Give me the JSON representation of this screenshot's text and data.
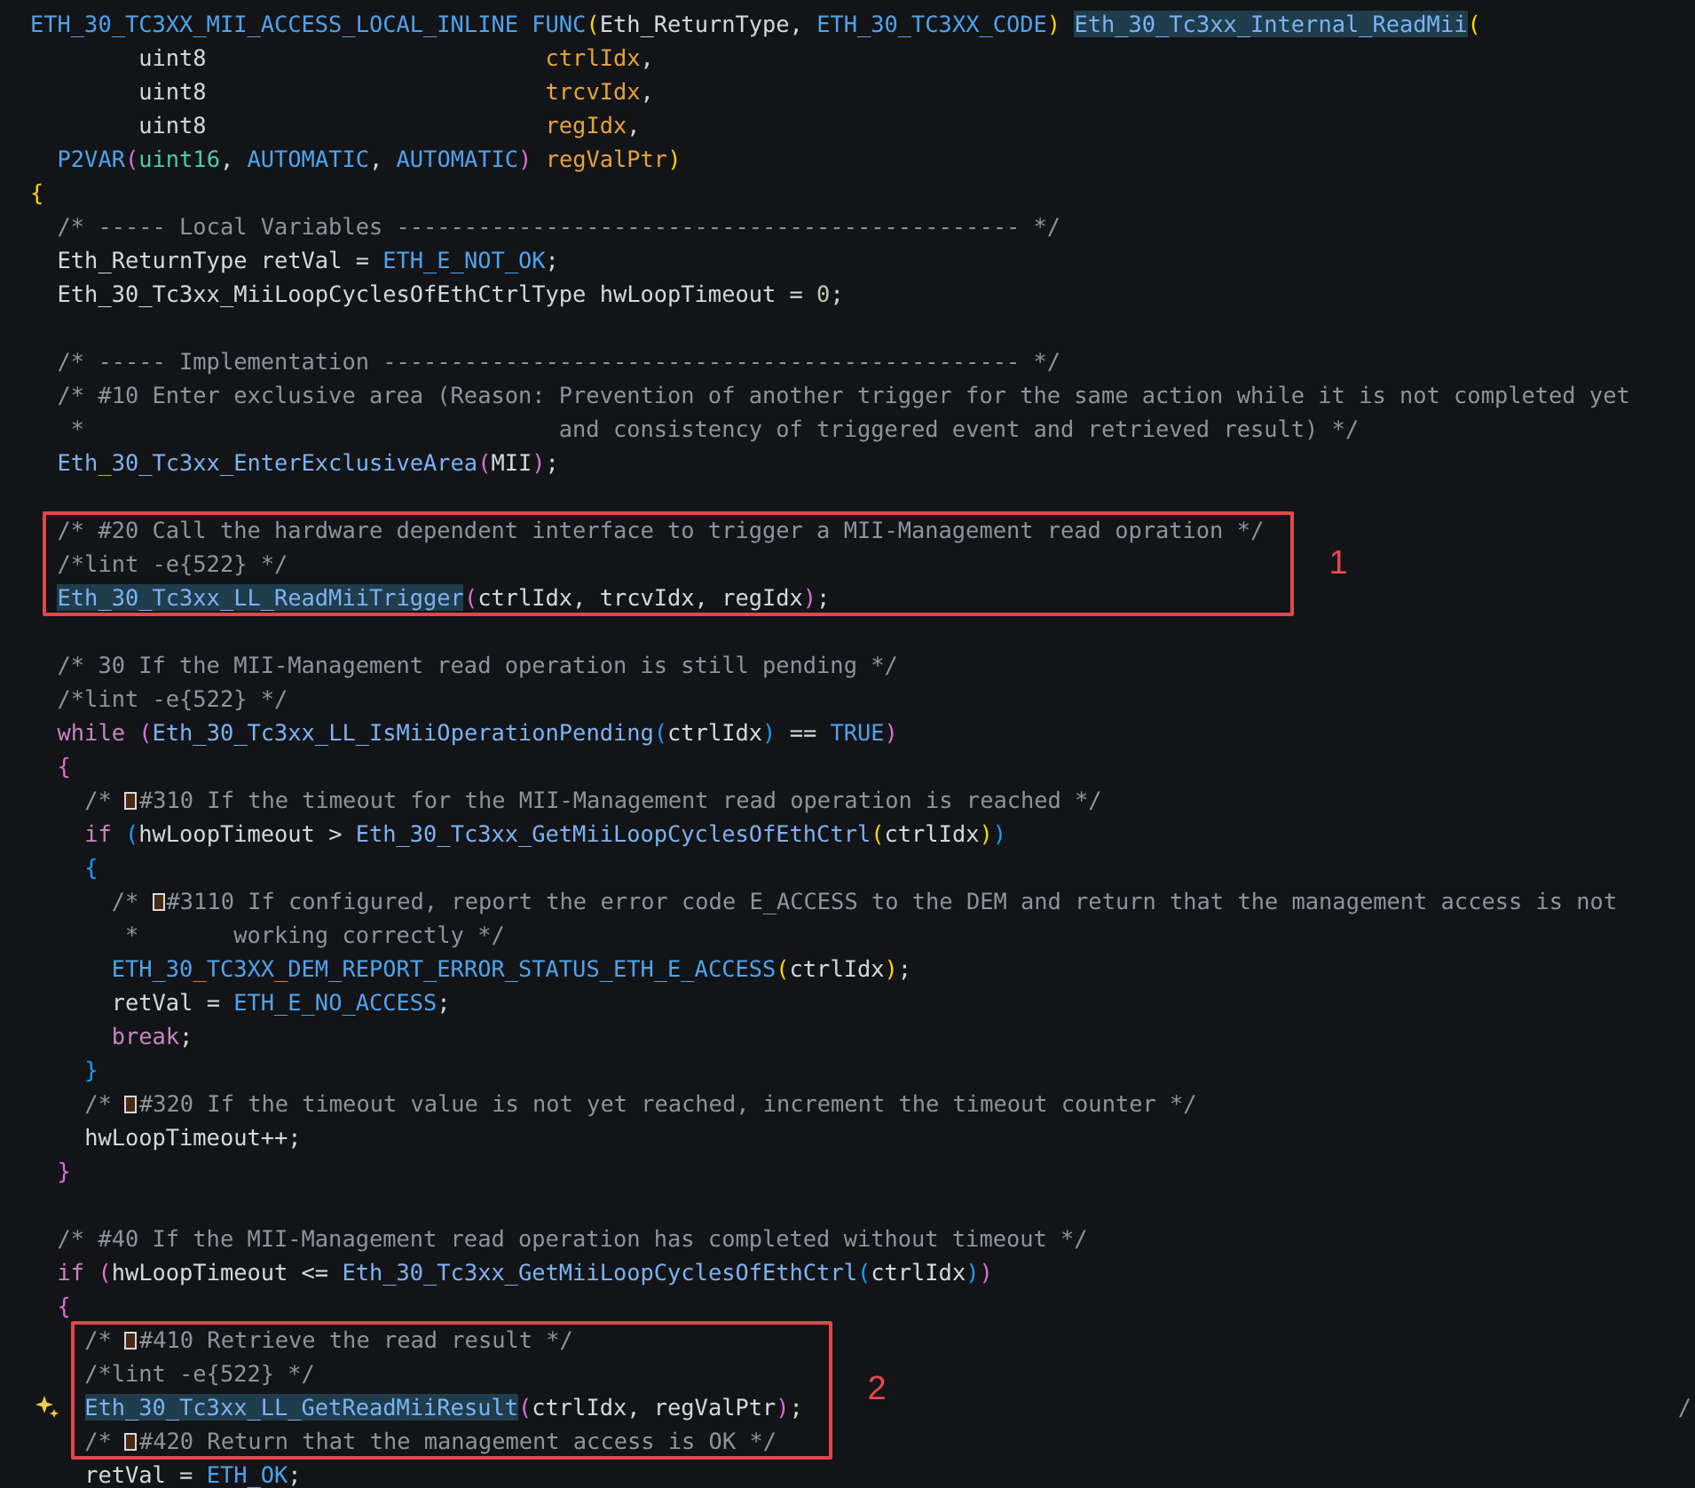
{
  "editor": {
    "lines": [
      {
        "kind": "code",
        "tokens": [
          {
            "kind": "macro",
            "text": "ETH_30_TC3XX_MII_ACCESS_LOCAL_INLINE"
          },
          {
            "kind": "macro",
            "text": " FUNC"
          },
          {
            "kind": "bracket",
            "text": "(",
            "color": "#ffd700"
          },
          {
            "kind": "plain",
            "text": "Eth_ReturnType, "
          },
          {
            "kind": "macro",
            "text": "ETH_30_TC3XX_CODE"
          },
          {
            "kind": "bracket",
            "text": ")",
            "color": "#ffd700"
          },
          {
            "kind": "fn",
            "text": " Eth_30_Tc3xx_Internal_ReadMii",
            "highlighted": true
          },
          {
            "kind": "bracket",
            "text": "(",
            "color": "#ffd700"
          }
        ]
      },
      {
        "kind": "code",
        "tokens": [
          {
            "kind": "plain",
            "text": "        uint8"
          },
          {
            "kind": "param",
            "text": "                         ctrlIdx"
          },
          {
            "kind": "plain",
            "text": ","
          }
        ]
      },
      {
        "kind": "code",
        "tokens": [
          {
            "kind": "plain",
            "text": "        uint8"
          },
          {
            "kind": "param",
            "text": "                         trcvIdx"
          },
          {
            "kind": "plain",
            "text": ","
          }
        ]
      },
      {
        "kind": "code",
        "tokens": [
          {
            "kind": "plain",
            "text": "        uint8"
          },
          {
            "kind": "param",
            "text": "                         regIdx"
          },
          {
            "kind": "plain",
            "text": ","
          }
        ]
      },
      {
        "kind": "code",
        "tokens": [
          {
            "kind": "macro",
            "text": "  P2VAR"
          },
          {
            "kind": "bracket",
            "text": "(",
            "color": "#da70d6"
          },
          {
            "kind": "type",
            "text": "uint16"
          },
          {
            "kind": "plain",
            "text": ", "
          },
          {
            "kind": "macro",
            "text": "AUTOMATIC"
          },
          {
            "kind": "plain",
            "text": ", "
          },
          {
            "kind": "macro",
            "text": "AUTOMATIC"
          },
          {
            "kind": "bracket",
            "text": ")",
            "color": "#da70d6"
          },
          {
            "kind": "param",
            "text": " regValPtr"
          },
          {
            "kind": "bracket",
            "text": ")",
            "color": "#ffd700"
          }
        ]
      },
      {
        "kind": "code",
        "tokens": [
          {
            "kind": "bracket",
            "text": "{",
            "color": "#ffd700"
          }
        ]
      },
      {
        "kind": "code",
        "tokens": [
          {
            "kind": "comment",
            "text": "  /* ----- Local Variables ---------------------------------------------- */"
          }
        ]
      },
      {
        "kind": "code",
        "tokens": [
          {
            "kind": "plain",
            "text": "  Eth_ReturnType retVal = "
          },
          {
            "kind": "macro",
            "text": "ETH_E_NOT_OK"
          },
          {
            "kind": "plain",
            "text": ";"
          }
        ]
      },
      {
        "kind": "code",
        "tokens": [
          {
            "kind": "plain",
            "text": "  Eth_30_Tc3xx_MiiLoopCyclesOfEthCtrlType hwLoopTimeout = "
          },
          {
            "kind": "number",
            "text": "0"
          },
          {
            "kind": "plain",
            "text": ";"
          }
        ]
      },
      {
        "kind": "blank"
      },
      {
        "kind": "code",
        "tokens": [
          {
            "kind": "comment",
            "text": "  /* ----- Implementation ----------------------------------------------- */"
          }
        ]
      },
      {
        "kind": "code",
        "tokens": [
          {
            "kind": "comment",
            "text": "  /* #10 Enter exclusive area (Reason: Prevention of another trigger for the same action while it is not completed yet"
          }
        ]
      },
      {
        "kind": "code",
        "tokens": [
          {
            "kind": "comment",
            "text": "   *                                   and consistency of triggered event and retrieved result) */"
          }
        ]
      },
      {
        "kind": "code",
        "tokens": [
          {
            "kind": "fn",
            "text": "  Eth_30_Tc3xx_EnterExclusiveArea",
            "highlighted": false
          },
          {
            "kind": "bracket",
            "text": "(",
            "color": "#da70d6"
          },
          {
            "kind": "plain",
            "text": "MII"
          },
          {
            "kind": "bracket",
            "text": ")",
            "color": "#da70d6"
          },
          {
            "kind": "plain",
            "text": ";"
          }
        ]
      },
      {
        "kind": "blank"
      },
      {
        "kind": "annotation",
        "label": "1",
        "lines": [
          {
            "kind": "code",
            "tokens": [
              {
                "kind": "comment",
                "text": "  /* #20 Call the hardware dependent interface to trigger a MII-Management read opration */"
              }
            ]
          },
          {
            "kind": "code",
            "tokens": [
              {
                "kind": "comment",
                "text": "  /*lint -e{522} */"
              }
            ]
          },
          {
            "kind": "code",
            "tokens": [
              {
                "kind": "fn",
                "text": "  Eth_30_Tc3xx_LL_ReadMiiTrigger",
                "highlighted": true
              },
              {
                "kind": "bracket",
                "text": "(",
                "color": "#da70d6"
              },
              {
                "kind": "plain",
                "text": "ctrlIdx, trcvIdx, regIdx"
              },
              {
                "kind": "bracket",
                "text": ")",
                "color": "#da70d6"
              },
              {
                "kind": "plain",
                "text": ";"
              }
            ]
          }
        ]
      },
      {
        "kind": "blank"
      },
      {
        "kind": "code",
        "tokens": [
          {
            "kind": "comment",
            "text": "  /* 30 If the MII-Management read operation is still pending */"
          }
        ]
      },
      {
        "kind": "code",
        "tokens": [
          {
            "kind": "comment",
            "text": "  /*lint -e{522} */"
          }
        ]
      },
      {
        "kind": "code",
        "tokens": [
          {
            "kind": "keyword",
            "text": "  while"
          },
          {
            "kind": "bracket",
            "text": " (",
            "color": "#da70d6"
          },
          {
            "kind": "fn",
            "text": "Eth_30_Tc3xx_LL_IsMiiOperationPending",
            "highlighted": false
          },
          {
            "kind": "bracket",
            "text": "(",
            "color": "#179fff"
          },
          {
            "kind": "plain",
            "text": "ctrlIdx"
          },
          {
            "kind": "bracket",
            "text": ")",
            "color": "#179fff"
          },
          {
            "kind": "plain",
            "text": " == "
          },
          {
            "kind": "macro",
            "text": "TRUE"
          },
          {
            "kind": "bracket",
            "text": ")",
            "color": "#da70d6"
          }
        ]
      },
      {
        "kind": "code",
        "tokens": [
          {
            "kind": "bracket",
            "text": "  {",
            "color": "#da70d6"
          }
        ]
      },
      {
        "kind": "code",
        "tokens": [
          {
            "kind": "comment",
            "text": "    /* "
          },
          {
            "kind": "glyph"
          },
          {
            "kind": "comment",
            "text": "#310 If the timeout for the MII-Management read operation is reached */"
          }
        ]
      },
      {
        "kind": "code",
        "tokens": [
          {
            "kind": "keyword",
            "text": "    if"
          },
          {
            "kind": "bracket",
            "text": " (",
            "color": "#179fff"
          },
          {
            "kind": "plain",
            "text": "hwLoopTimeout > "
          },
          {
            "kind": "fn",
            "text": "Eth_30_Tc3xx_GetMiiLoopCyclesOfEthCtrl",
            "highlighted": false
          },
          {
            "kind": "bracket",
            "text": "(",
            "color": "#ffd700"
          },
          {
            "kind": "plain",
            "text": "ctrlIdx"
          },
          {
            "kind": "bracket",
            "text": ")",
            "color": "#ffd700"
          },
          {
            "kind": "bracket",
            "text": ")",
            "color": "#179fff"
          }
        ]
      },
      {
        "kind": "code",
        "tokens": [
          {
            "kind": "bracket",
            "text": "    {",
            "color": "#179fff"
          }
        ]
      },
      {
        "kind": "code",
        "tokens": [
          {
            "kind": "comment",
            "text": "      /* "
          },
          {
            "kind": "glyph"
          },
          {
            "kind": "comment",
            "text": "#3110 If configured, report the error code E_ACCESS to the DEM and return that the management access is not"
          }
        ]
      },
      {
        "kind": "code",
        "tokens": [
          {
            "kind": "comment",
            "text": "       *       working correctly */"
          }
        ]
      },
      {
        "kind": "code",
        "tokens": [
          {
            "kind": "macro",
            "text": "      ETH_30_TC3XX_DEM_REPORT_ERROR_STATUS_ETH_E_ACCESS"
          },
          {
            "kind": "bracket",
            "text": "(",
            "color": "#ffd700"
          },
          {
            "kind": "plain",
            "text": "ctrlIdx"
          },
          {
            "kind": "bracket",
            "text": ")",
            "color": "#ffd700"
          },
          {
            "kind": "plain",
            "text": ";"
          }
        ]
      },
      {
        "kind": "code",
        "tokens": [
          {
            "kind": "plain",
            "text": "      retVal = "
          },
          {
            "kind": "macro",
            "text": "ETH_E_NO_ACCESS"
          },
          {
            "kind": "plain",
            "text": ";"
          }
        ]
      },
      {
        "kind": "code",
        "tokens": [
          {
            "kind": "keyword",
            "text": "      break"
          },
          {
            "kind": "plain",
            "text": ";"
          }
        ]
      },
      {
        "kind": "code",
        "tokens": [
          {
            "kind": "bracket",
            "text": "    }",
            "color": "#179fff"
          }
        ]
      },
      {
        "kind": "code",
        "tokens": [
          {
            "kind": "comment",
            "text": "    /* "
          },
          {
            "kind": "glyph"
          },
          {
            "kind": "comment",
            "text": "#320 If the timeout value is not yet reached, increment the timeout counter */"
          }
        ]
      },
      {
        "kind": "code",
        "tokens": [
          {
            "kind": "plain",
            "text": "    hwLoopTimeout++;"
          }
        ]
      },
      {
        "kind": "code",
        "tokens": [
          {
            "kind": "bracket",
            "text": "  }",
            "color": "#da70d6"
          }
        ]
      },
      {
        "kind": "blank"
      },
      {
        "kind": "code",
        "tokens": [
          {
            "kind": "comment",
            "text": "  /* #40 If the MII-Management read operation has completed without timeout */"
          }
        ]
      },
      {
        "kind": "code",
        "tokens": [
          {
            "kind": "keyword",
            "text": "  if"
          },
          {
            "kind": "bracket",
            "text": " (",
            "color": "#da70d6"
          },
          {
            "kind": "plain",
            "text": "hwLoopTimeout <= "
          },
          {
            "kind": "fn",
            "text": "Eth_30_Tc3xx_GetMiiLoopCyclesOfEthCtrl",
            "highlighted": false
          },
          {
            "kind": "bracket",
            "text": "(",
            "color": "#179fff"
          },
          {
            "kind": "plain",
            "text": "ctrlIdx"
          },
          {
            "kind": "bracket",
            "text": ")",
            "color": "#179fff"
          },
          {
            "kind": "bracket",
            "text": ")",
            "color": "#da70d6"
          }
        ]
      },
      {
        "kind": "code",
        "tokens": [
          {
            "kind": "bracket",
            "text": "  {",
            "color": "#da70d6"
          }
        ]
      },
      {
        "kind": "annotation",
        "label": "2",
        "lines": [
          {
            "kind": "code",
            "tokens": [
              {
                "kind": "comment",
                "text": "    /* "
              },
              {
                "kind": "glyph"
              },
              {
                "kind": "comment",
                "text": "#410 Retrieve the read result */"
              }
            ]
          },
          {
            "kind": "code",
            "tokens": [
              {
                "kind": "comment",
                "text": "    /*lint -e{522} */"
              }
            ]
          },
          {
            "kind": "code",
            "hint": true,
            "edge_text": "/",
            "tokens": [
              {
                "kind": "fn",
                "text": "    Eth_30_Tc3xx_LL_GetReadMiiResult",
                "highlighted": true
              },
              {
                "kind": "bracket",
                "text": "(",
                "color": "#da70d6"
              },
              {
                "kind": "plain",
                "text": "ctrlIdx, regValPtr"
              },
              {
                "kind": "bracket",
                "text": ")",
                "color": "#da70d6"
              },
              {
                "kind": "plain",
                "text": ";"
              }
            ]
          },
          {
            "kind": "code",
            "tokens": [
              {
                "kind": "comment",
                "text": "    /* "
              },
              {
                "kind": "glyph"
              },
              {
                "kind": "comment",
                "text": "#420 Return that the management access is OK */"
              }
            ]
          }
        ]
      },
      {
        "kind": "code",
        "tokens": [
          {
            "kind": "plain",
            "text": "    retVal = "
          },
          {
            "kind": "macro",
            "text": "ETH_OK"
          },
          {
            "kind": "plain",
            "text": ";"
          }
        ]
      }
    ]
  }
}
